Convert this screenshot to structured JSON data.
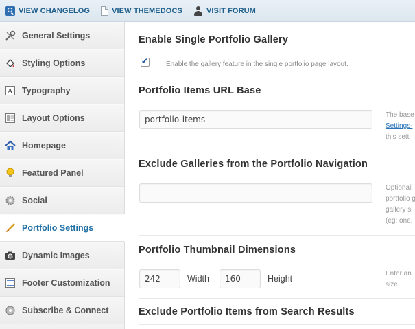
{
  "topbar": {
    "links": [
      {
        "label": "VIEW CHANGELOG",
        "icon": "search-icon"
      },
      {
        "label": "VIEW THEMEDOCS",
        "icon": "document-icon"
      },
      {
        "label": "VISIT FORUM",
        "icon": "person-icon"
      }
    ]
  },
  "sidebar": {
    "items": [
      {
        "label": "General Settings",
        "icon": "tools-icon"
      },
      {
        "label": "Styling Options",
        "icon": "paint-bucket-icon"
      },
      {
        "label": "Typography",
        "icon": "text-icon"
      },
      {
        "label": "Layout Options",
        "icon": "layout-icon"
      },
      {
        "label": "Homepage",
        "icon": "home-icon"
      },
      {
        "label": "Featured Panel",
        "icon": "lightbulb-icon"
      },
      {
        "label": "Social",
        "icon": "gear-icon"
      },
      {
        "label": "Portfolio Settings",
        "icon": "brush-icon",
        "active": true
      },
      {
        "label": "Dynamic Images",
        "icon": "camera-icon"
      },
      {
        "label": "Footer Customization",
        "icon": "footer-icon"
      },
      {
        "label": "Subscribe & Connect",
        "icon": "connect-icon"
      }
    ]
  },
  "main": {
    "gallery": {
      "title": "Enable Single Portfolio Gallery",
      "checked": true,
      "description": "Enable the gallery feature in the single portfolio page layout."
    },
    "url_base": {
      "title": "Portfolio Items URL Base",
      "value": "portfolio-items",
      "help": [
        "The base",
        "Settings-",
        "this setti"
      ]
    },
    "exclude_galleries": {
      "title": "Exclude Galleries from the Portfolio Navigation",
      "value": "",
      "help": [
        "Optionall",
        "portfolio g",
        "gallery sl",
        "(eg: one,"
      ]
    },
    "thumbnail": {
      "title": "Portfolio Thumbnail Dimensions",
      "width_value": "242",
      "width_label": "Width",
      "height_value": "160",
      "height_label": "Height",
      "help": [
        "Enter an",
        "size."
      ]
    },
    "exclude_search": {
      "title": "Exclude Portfolio Items from Search Results"
    }
  }
}
